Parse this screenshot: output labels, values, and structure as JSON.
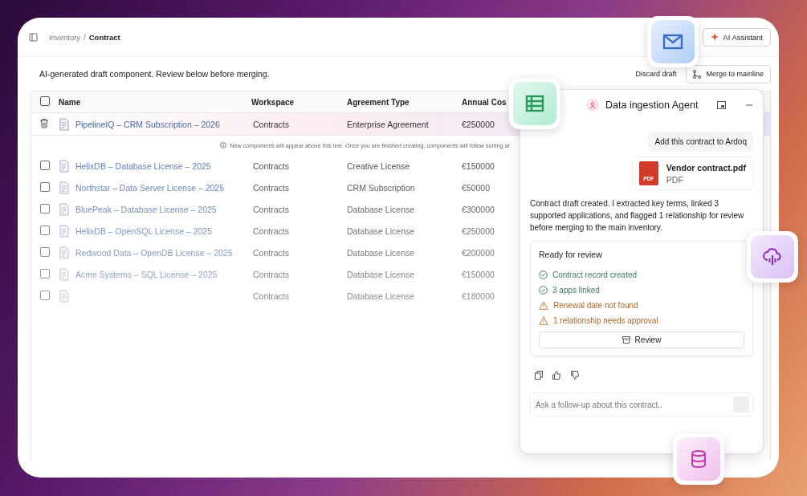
{
  "breadcrumb": {
    "parent": "Inventory",
    "separator": "/",
    "current": "Contract"
  },
  "ai_assistant_button": "AI Assistant",
  "draft_banner": {
    "message": "AI-generated draft component. Review below before merging.",
    "discard": "Discard draft",
    "merge": "Merge to mainline"
  },
  "table": {
    "select_all": {
      "checked": false
    },
    "columns": [
      "Name",
      "Workspace",
      "Agreement Type",
      "Annual Cos"
    ],
    "draft_row": {
      "name": "PipelineIQ – CRM Subscription – 2026",
      "workspace": "Contracts",
      "agreement_type": "Enterprise Agreement",
      "annual_cost": "€250000"
    },
    "notice": "New components will appear above this line. Once you are finished creating, components will follow sorting ar",
    "rows": [
      {
        "name": "HelixDB – Database License – 2025",
        "workspace": "Contracts",
        "agreement_type": "Creative License",
        "annual_cost": "€150000",
        "checked": false
      },
      {
        "name": "Northstar – Data Server License – 2025",
        "workspace": "Contracts",
        "agreement_type": "CRM Subscription",
        "annual_cost": "€50000",
        "checked": false
      },
      {
        "name": "BluePeak  –  Database License – 2025",
        "workspace": "Contracts",
        "agreement_type": "Database License",
        "annual_cost": "€300000",
        "checked": false
      },
      {
        "name": "HelixDB – OpenSQL License – 2025",
        "workspace": "Contracts",
        "agreement_type": "Database License",
        "annual_cost": "€250000",
        "checked": false
      },
      {
        "name": "Redwood Data – OpenDB License – 2025",
        "workspace": "Contracts",
        "agreement_type": "Database License",
        "annual_cost": "€200000",
        "checked": false
      },
      {
        "name": "Acme Systems – SQL License – 2025",
        "workspace": "Contracts",
        "agreement_type": "Database License",
        "annual_cost": "€150000",
        "checked": false
      },
      {
        "workspace": "Contracts",
        "agreement_type": "Database License",
        "annual_cost": "€180000",
        "checked": false
      }
    ]
  },
  "chat": {
    "title": "Data ingestion Agent",
    "user_message": "Add this contract to Ardoq",
    "attachment": {
      "name": "Vendor contract.pdf",
      "type": "PDF",
      "badge": "PDF"
    },
    "response": "Contract draft created. I extracted key terms, linked 3 supported applications, and flagged 1 relationship for review before merging to the main inventory.",
    "review_card": {
      "title": "Ready for review",
      "items": [
        {
          "kind": "success",
          "text": "Contract record created"
        },
        {
          "kind": "success",
          "text": "3 apps linked"
        },
        {
          "kind": "warning",
          "text": "Renewal date not found"
        },
        {
          "kind": "warning",
          "text": "1 relationship needs approval"
        }
      ],
      "button": "Review"
    },
    "input": {
      "placeholder": "Ask a follow-up about this contract.."
    }
  }
}
